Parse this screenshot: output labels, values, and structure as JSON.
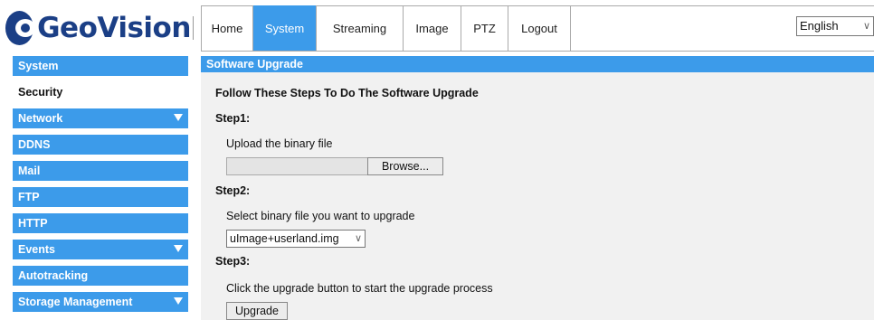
{
  "brand": {
    "name": "GeoVision"
  },
  "nav": {
    "tabs": [
      {
        "label": "Home"
      },
      {
        "label": "System",
        "active": true
      },
      {
        "label": "Streaming"
      },
      {
        "label": "Image"
      },
      {
        "label": "PTZ"
      },
      {
        "label": "Logout"
      }
    ],
    "language": "English"
  },
  "sidebar": {
    "items": [
      {
        "label": "System",
        "expandable": false
      },
      {
        "label": "Security",
        "active": true
      },
      {
        "label": "Network",
        "expandable": true
      },
      {
        "label": "DDNS"
      },
      {
        "label": "Mail"
      },
      {
        "label": "FTP"
      },
      {
        "label": "HTTP"
      },
      {
        "label": "Events",
        "expandable": true
      },
      {
        "label": "Autotracking"
      },
      {
        "label": "Storage Management",
        "expandable": true
      }
    ]
  },
  "main": {
    "title": "Software Upgrade",
    "intro": "Follow These Steps To Do The Software Upgrade",
    "step1": {
      "heading": "Step1:",
      "text": "Upload the binary file",
      "browse_label": "Browse..."
    },
    "step2": {
      "heading": "Step2:",
      "text": "Select binary file you want to upgrade",
      "selected": "uImage+userland.img"
    },
    "step3": {
      "heading": "Step3:",
      "text": "Click the upgrade button to start the upgrade process",
      "button_label": "Upgrade"
    }
  },
  "colors": {
    "accent": "#3c9bea",
    "brand": "#1b3f86"
  }
}
